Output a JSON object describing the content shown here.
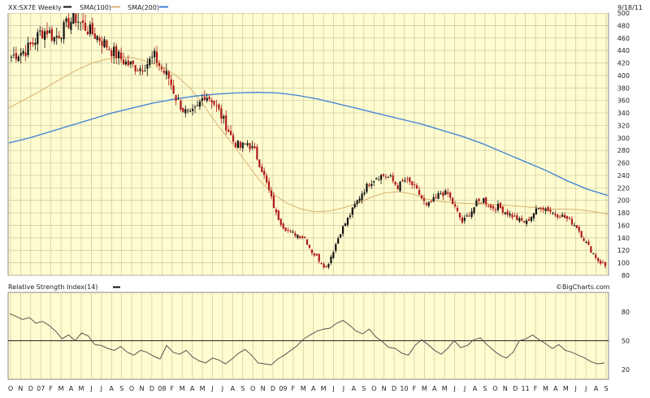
{
  "header": {
    "symbol_label": "XX:SX7E Weekly",
    "legend_sma100": "SMA(100)",
    "legend_sma200": "SMA(200)",
    "date_label": "9/18/11"
  },
  "indicator": {
    "title": "Relative Strength Index(14)",
    "watermark": "©BigCharts.com"
  },
  "colors": {
    "background": "#fffccf",
    "grid": "#c9c7a2",
    "candle_up": "#111111",
    "candle_down": "#b01818",
    "sma100": "#d8b070",
    "sma200": "#3a7fd6",
    "rsi": "#555555",
    "rsi_ref": "#222222"
  },
  "chart_data": [
    {
      "type": "candlestick",
      "title": "XX:SX7E Weekly",
      "ylim": [
        80,
        500
      ],
      "y_ticks": [
        80,
        100,
        120,
        140,
        160,
        180,
        200,
        220,
        240,
        260,
        280,
        300,
        320,
        340,
        360,
        380,
        400,
        420,
        440,
        460,
        480,
        500
      ],
      "x_tick_labels": [
        "O",
        "N",
        "D",
        "07",
        "F",
        "M",
        "A",
        "M",
        "J",
        "J",
        "A",
        "S",
        "O",
        "N",
        "D",
        "08",
        "F",
        "M",
        "A",
        "M",
        "J",
        "J",
        "A",
        "S",
        "O",
        "N",
        "D",
        "09",
        "F",
        "M",
        "A",
        "M",
        "J",
        "J",
        "A",
        "S",
        "O",
        "N",
        "D",
        "10",
        "F",
        "M",
        "A",
        "M",
        "J",
        "J",
        "A",
        "S",
        "O",
        "N",
        "D",
        "11",
        "F",
        "M",
        "A",
        "M",
        "J",
        "J",
        "A",
        "S"
      ],
      "x_range": [
        "2006-10",
        "2011-09"
      ],
      "close_series": [
        430,
        436,
        440,
        452,
        468,
        472,
        460,
        470,
        485,
        492,
        480,
        470,
        462,
        452,
        440,
        430,
        420,
        415,
        412,
        420,
        430,
        410,
        396,
        365,
        345,
        335,
        348,
        370,
        362,
        342,
        320,
        295,
        285,
        292,
        278,
        250,
        215,
        178,
        158,
        148,
        145,
        140,
        118,
        105,
        92,
        120,
        150,
        170,
        192,
        212,
        228,
        238,
        240,
        235,
        222,
        232,
        225,
        210,
        190,
        200,
        212,
        210,
        188,
        165,
        178,
        195,
        202,
        188,
        190,
        182,
        175,
        168,
        165,
        180,
        190,
        185,
        178,
        175,
        168,
        158,
        138,
        120,
        104,
        95
      ],
      "series": [
        {
          "name": "SMA(100)",
          "values": [
            348,
            360,
            372,
            385,
            398,
            410,
            420,
            426,
            430,
            428,
            422,
            414,
            400,
            380,
            352,
            320,
            292,
            262,
            232,
            210,
            195,
            186,
            182,
            183,
            188,
            195,
            205,
            212,
            214,
            210,
            202,
            198,
            196,
            195,
            194,
            193,
            192,
            190,
            188,
            186,
            186,
            185,
            182,
            178
          ]
        },
        {
          "name": "SMA(200)",
          "values": [
            292,
            300,
            310,
            320,
            330,
            340,
            348,
            356,
            362,
            367,
            370,
            372,
            373,
            372,
            368,
            362,
            354,
            346,
            338,
            330,
            322,
            312,
            302,
            290,
            276,
            262,
            248,
            232,
            218,
            208
          ]
        }
      ]
    },
    {
      "type": "line",
      "title": "Relative Strength Index(14)",
      "ylim": [
        10,
        100
      ],
      "y_ticks": [
        20,
        50,
        80
      ],
      "reference_line": 50,
      "series": [
        {
          "name": "Relative Strength Index(14)",
          "values": [
            78,
            75,
            72,
            74,
            68,
            70,
            66,
            60,
            52,
            56,
            50,
            58,
            55,
            46,
            45,
            42,
            40,
            44,
            38,
            35,
            40,
            38,
            34,
            31,
            45,
            38,
            36,
            40,
            33,
            29,
            27,
            32,
            30,
            26,
            31,
            37,
            41,
            35,
            27,
            26,
            25,
            31,
            35,
            40,
            45,
            52,
            56,
            60,
            62,
            63,
            68,
            71,
            66,
            60,
            57,
            62,
            54,
            49,
            43,
            42,
            37,
            35,
            45,
            51,
            46,
            40,
            36,
            42,
            50,
            43,
            45,
            51,
            53,
            46,
            40,
            35,
            32,
            38,
            50,
            52,
            56,
            51,
            47,
            42,
            46,
            40,
            38,
            35,
            32,
            28,
            26,
            27
          ]
        }
      ]
    }
  ]
}
